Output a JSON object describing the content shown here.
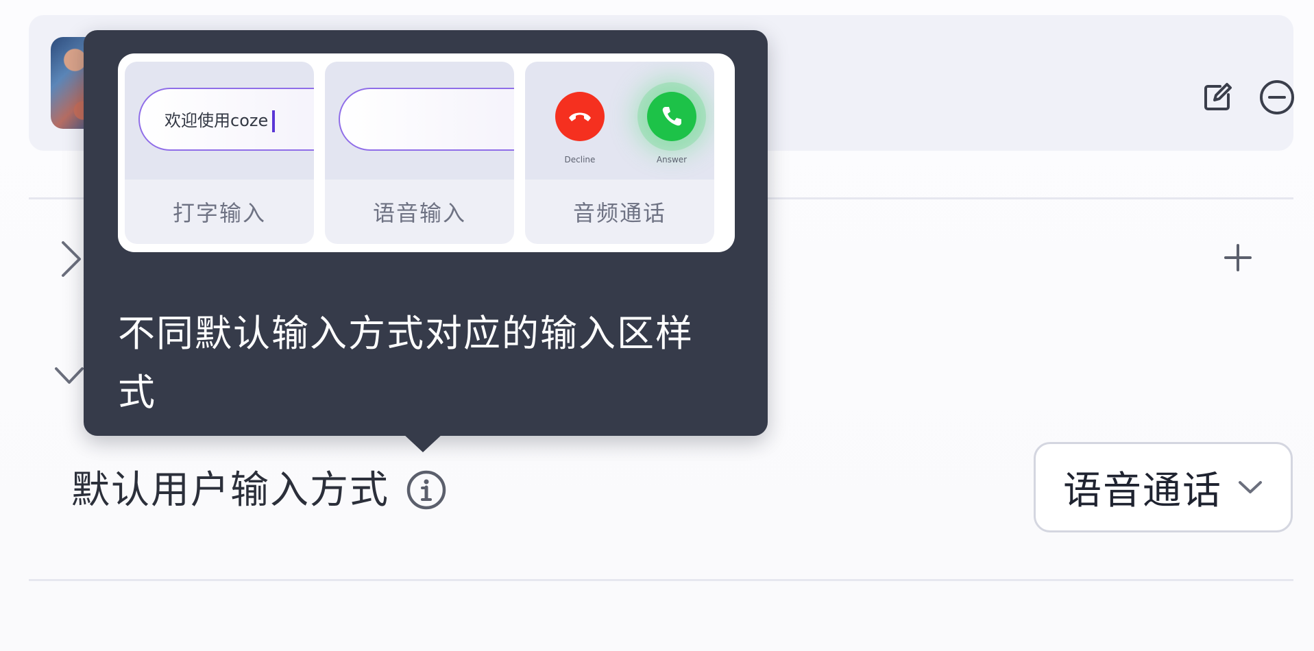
{
  "settings": {
    "default_input_label": "默认用户输入方式",
    "default_input_value": "语音通话"
  },
  "tooltip": {
    "options": [
      {
        "label": "打字输入",
        "sample_text": "欢迎使用coze"
      },
      {
        "label": "语音输入"
      },
      {
        "label": "音频通话",
        "decline_caption": "Decline",
        "answer_caption": "Answer"
      }
    ],
    "description": "不同默认输入方式对应的输入区样式"
  },
  "icons": {
    "edit": "edit-icon",
    "remove": "remove-circle-icon",
    "expand_right": "chevron-right-icon",
    "collapse_down": "chevron-down-icon",
    "add": "plus-icon",
    "info": "info-icon",
    "select": "chevron-down-icon"
  },
  "colors": {
    "tooltip_bg": "#363b4a",
    "accent_purple": "#8f6de8",
    "decline_red": "#f5301f",
    "answer_green": "#1dc248"
  }
}
